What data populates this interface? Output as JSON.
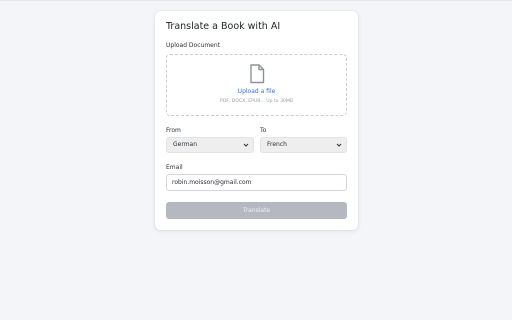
{
  "form": {
    "title": "Translate a Book with AI",
    "upload_label": "Upload Document",
    "upload_link": "Upload a file",
    "upload_hint": "PDF, DOCX, EPUB... Up to 30MB",
    "from_label": "From",
    "from_value": "German",
    "to_label": "To",
    "to_value": "French",
    "email_label": "Email",
    "email_value": "robin.moisson@gmail.com",
    "submit_label": "Translate"
  },
  "icons": {
    "upload": "file-icon",
    "from_select": "chevron-down-icon",
    "to_select": "chevron-down-icon"
  },
  "colors": {
    "link": "#3b6fd6",
    "button_disabled": "#b4b9c1"
  }
}
